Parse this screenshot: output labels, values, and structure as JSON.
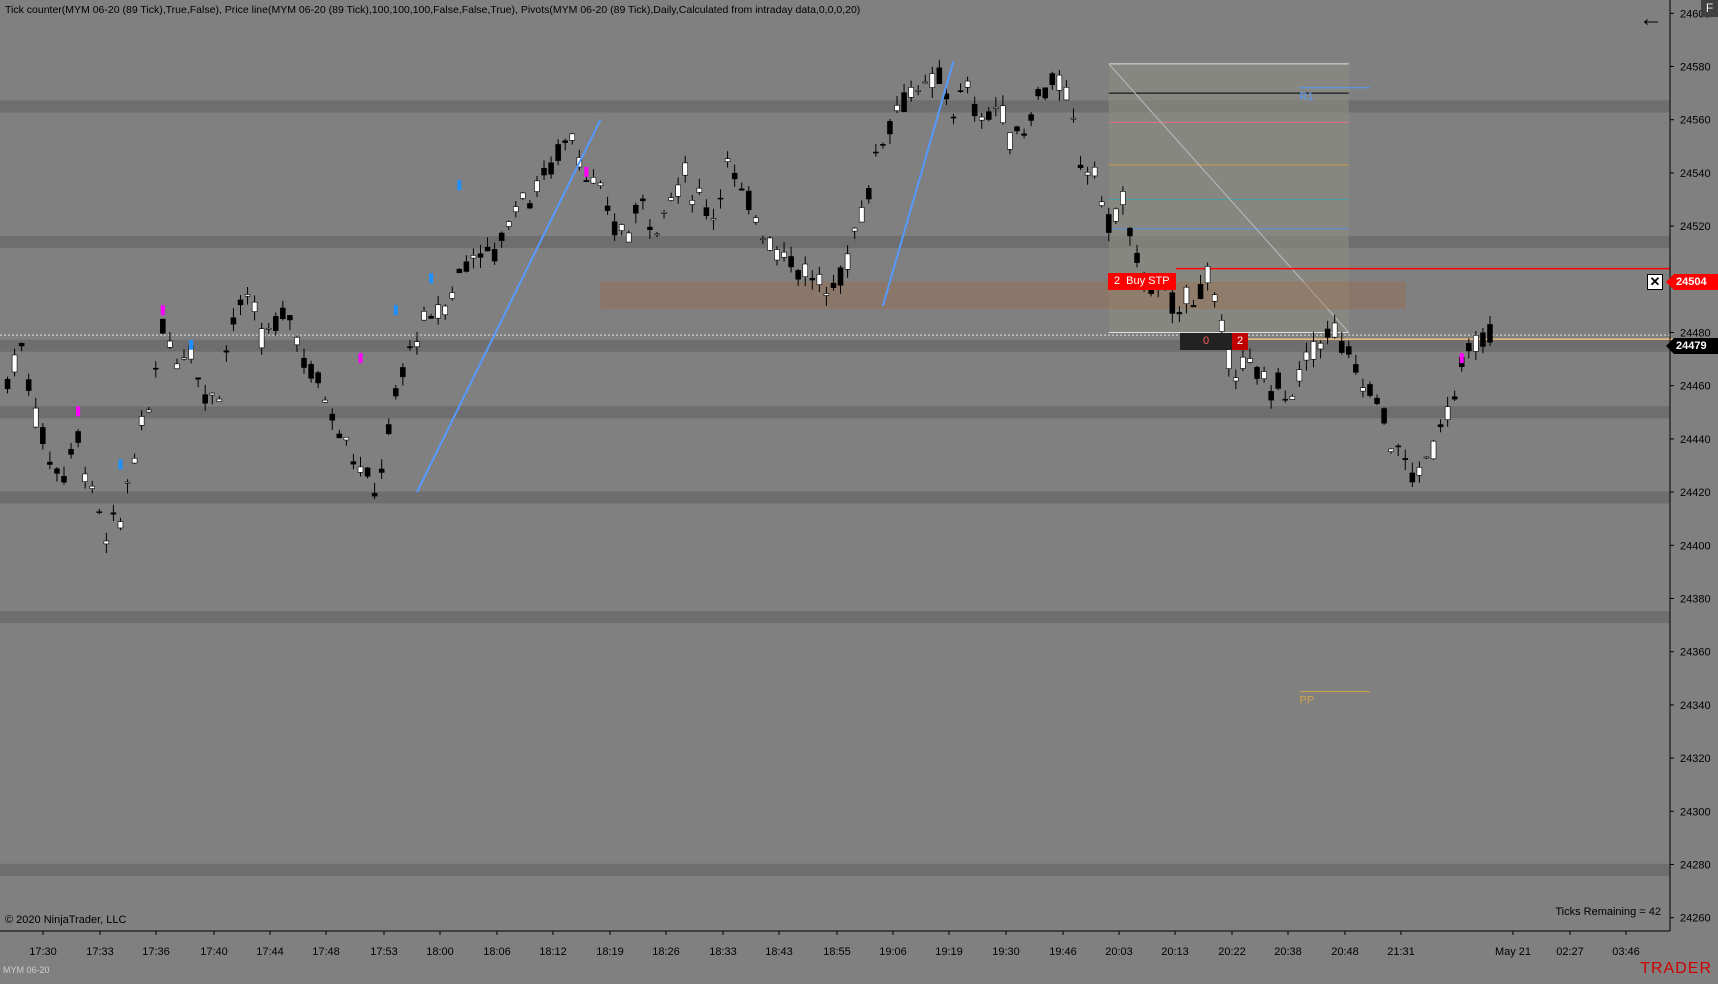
{
  "indicator_label": "Tick counter(MYM 06-20 (89 Tick),True,False), Price line(MYM 06-20 (89 Tick),100,100,100,False,False,True), Pivots(MYM 06-20 (89 Tick),Daily,Calculated from intraday data,0,0,0,20)",
  "ticks_remaining": "Ticks Remaining = 42",
  "copyright": "© 2020 NinjaTrader, LLC",
  "instrument": "MYM 06-20",
  "brand": "TRADER",
  "corner_button": "F",
  "order": {
    "qty": "2",
    "label": "Buy STP",
    "price": "24504",
    "close_icon": "close-x-icon"
  },
  "last_price": "24479",
  "position": {
    "pnl": "0",
    "qty": "2"
  },
  "pivot_labels": {
    "pp": "PP",
    "r1": "R1"
  },
  "colors": {
    "background": "#808080",
    "buy_stop": "#ff0000",
    "trendline": "#5599ff",
    "pivot": "#d4a24a",
    "zone_fill": "#a06840",
    "marker_magenta": "#ff00ff",
    "marker_blue": "#1e90ff"
  },
  "chart_data": {
    "type": "candlestick",
    "y_ticks": [
      24600,
      24580,
      24560,
      24540,
      24520,
      24500,
      24480,
      24460,
      24440,
      24420,
      24400,
      24380,
      24360,
      24340,
      24320,
      24300,
      24280,
      24260
    ],
    "x_ticks": [
      "17:30",
      "17:33",
      "17:36",
      "17:40",
      "17:44",
      "17:48",
      "17:53",
      "18:00",
      "18:06",
      "18:12",
      "18:19",
      "18:26",
      "18:33",
      "18:43",
      "18:55",
      "19:06",
      "19:19",
      "19:30",
      "19:46",
      "20:03",
      "20:13",
      "20:22",
      "20:38",
      "20:48",
      "21:31",
      "May 21",
      "02:27",
      "03:46"
    ],
    "ylim": [
      24255,
      24605
    ],
    "price_path": [
      [
        0,
        24462
      ],
      [
        2,
        24475
      ],
      [
        4,
        24450
      ],
      [
        6,
        24432
      ],
      [
        8,
        24428
      ],
      [
        10,
        24440
      ],
      [
        12,
        24420
      ],
      [
        14,
        24402
      ],
      [
        16,
        24410
      ],
      [
        18,
        24435
      ],
      [
        20,
        24450
      ],
      [
        22,
        24484
      ],
      [
        24,
        24470
      ],
      [
        26,
        24476
      ],
      [
        28,
        24455
      ],
      [
        30,
        24460
      ],
      [
        32,
        24486
      ],
      [
        34,
        24492
      ],
      [
        36,
        24478
      ],
      [
        38,
        24482
      ],
      [
        40,
        24488
      ],
      [
        42,
        24470
      ],
      [
        44,
        24462
      ],
      [
        46,
        24450
      ],
      [
        48,
        24440
      ],
      [
        50,
        24428
      ],
      [
        52,
        24420
      ],
      [
        54,
        24442
      ],
      [
        56,
        24466
      ],
      [
        58,
        24480
      ],
      [
        60,
        24485
      ],
      [
        62,
        24490
      ],
      [
        64,
        24502
      ],
      [
        66,
        24512
      ],
      [
        68,
        24508
      ],
      [
        70,
        24515
      ],
      [
        72,
        24530
      ],
      [
        74,
        24532
      ],
      [
        76,
        24538
      ],
      [
        78,
        24548
      ],
      [
        80,
        24555
      ],
      [
        82,
        24540
      ],
      [
        84,
        24530
      ],
      [
        86,
        24520
      ],
      [
        88,
        24518
      ],
      [
        90,
        24530
      ],
      [
        92,
        24520
      ],
      [
        94,
        24532
      ],
      [
        96,
        24538
      ],
      [
        98,
        24530
      ],
      [
        100,
        24525
      ],
      [
        102,
        24545
      ],
      [
        104,
        24530
      ],
      [
        106,
        24525
      ],
      [
        108,
        24515
      ],
      [
        110,
        24510
      ],
      [
        112,
        24505
      ],
      [
        114,
        24500
      ],
      [
        116,
        24495
      ],
      [
        118,
        24500
      ],
      [
        120,
        24518
      ],
      [
        122,
        24535
      ],
      [
        124,
        24555
      ],
      [
        126,
        24565
      ],
      [
        128,
        24572
      ],
      [
        130,
        24570
      ],
      [
        132,
        24575
      ],
      [
        134,
        24565
      ],
      [
        136,
        24570
      ],
      [
        138,
        24560
      ],
      [
        140,
        24565
      ],
      [
        142,
        24555
      ],
      [
        144,
        24555
      ],
      [
        146,
        24570
      ],
      [
        148,
        24575
      ],
      [
        150,
        24568
      ],
      [
        152,
        24545
      ],
      [
        154,
        24540
      ],
      [
        156,
        24520
      ],
      [
        158,
        24530
      ],
      [
        160,
        24505
      ],
      [
        162,
        24498
      ],
      [
        164,
        24492
      ],
      [
        166,
        24490
      ],
      [
        168,
        24495
      ],
      [
        170,
        24500
      ],
      [
        172,
        24478
      ],
      [
        174,
        24468
      ],
      [
        176,
        24465
      ],
      [
        178,
        24462
      ],
      [
        180,
        24460
      ],
      [
        182,
        24455
      ],
      [
        184,
        24470
      ],
      [
        186,
        24478
      ],
      [
        188,
        24480
      ],
      [
        190,
        24470
      ],
      [
        192,
        24462
      ],
      [
        194,
        24455
      ],
      [
        196,
        24440
      ],
      [
        198,
        24430
      ],
      [
        200,
        24425
      ],
      [
        202,
        24438
      ],
      [
        204,
        24452
      ],
      [
        206,
        24466
      ],
      [
        208,
        24475
      ],
      [
        210,
        24478
      ]
    ],
    "trendlines": [
      {
        "from": [
          58,
          24420
        ],
        "to": [
          84,
          24560
        ]
      },
      {
        "from": [
          124,
          24490
        ],
        "to": [
          134,
          24582
        ]
      }
    ],
    "pivot_levels": [
      {
        "name": "R1",
        "value": 24572,
        "from_x": 183,
        "to_x": 193
      },
      {
        "name": "PP",
        "value": 24345,
        "from_x": 183,
        "to_x": 193
      }
    ],
    "fib_levels": [
      {
        "value": 24581,
        "color": "#e0e0e0"
      },
      {
        "value": 24570,
        "color": "#000000"
      },
      {
        "value": 24559,
        "color": "#e07080"
      },
      {
        "value": 24543,
        "color": "#c8a040"
      },
      {
        "value": 24530,
        "color": "#40a0a0"
      },
      {
        "value": 24519,
        "color": "#6090e0"
      },
      {
        "value": 24480,
        "color": "#e0e0e0"
      }
    ],
    "fib_range": {
      "from_x": 156,
      "to_x": 190,
      "top": 24581,
      "bottom": 24480
    },
    "zone": {
      "from_x": 84,
      "to_x": 198,
      "top": 24499,
      "bottom": 24489
    },
    "volume_bands": [
      24565,
      24514,
      24475,
      24450,
      24418,
      24373,
      24278
    ],
    "buy_stop_price": 24504,
    "last_price": 24479,
    "bars_total": 236
  }
}
